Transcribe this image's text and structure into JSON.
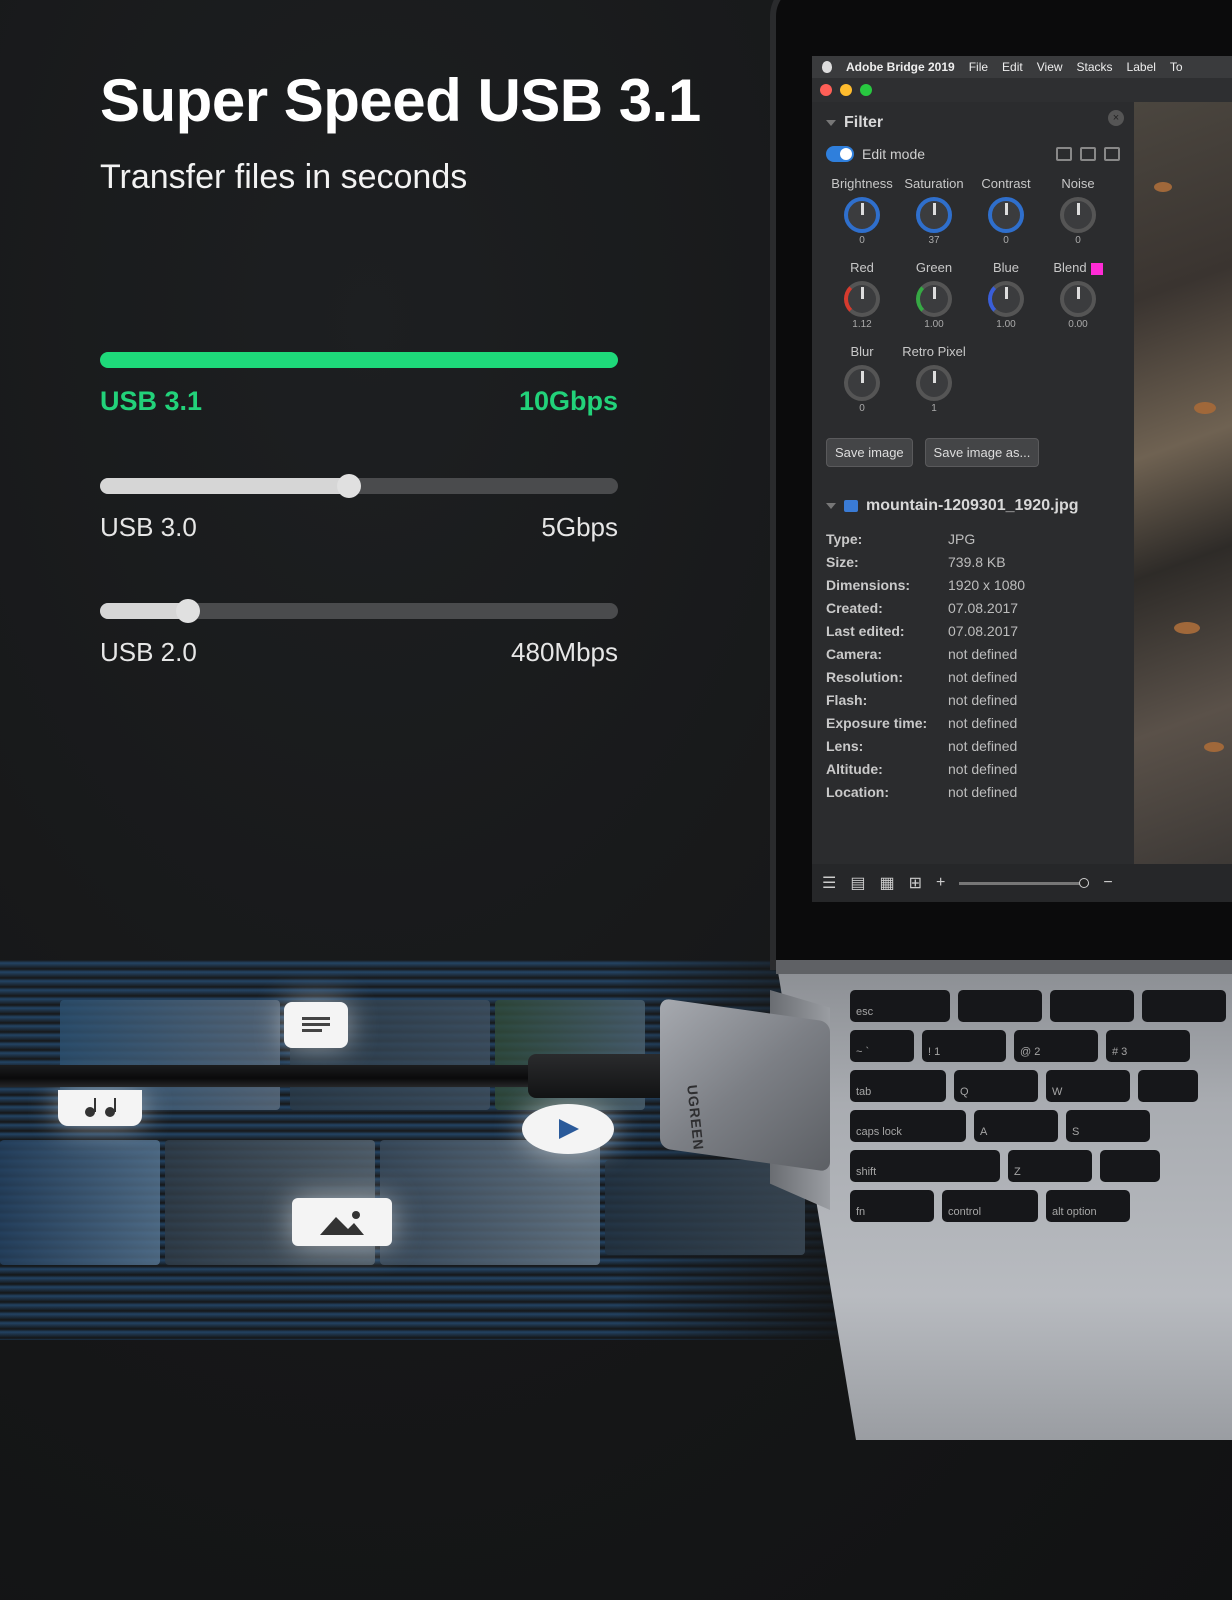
{
  "headline": "Super Speed USB 3.1",
  "subline": "Transfer files in seconds",
  "speeds": [
    {
      "name": "USB 3.1",
      "rate": "10Gbps",
      "level": 1.0
    },
    {
      "name": "USB 3.0",
      "rate": "5Gbps",
      "level": 0.48
    },
    {
      "name": "USB 2.0",
      "rate": "480Mbps",
      "level": 0.17
    }
  ],
  "colors": {
    "accent": "#1ed97a",
    "background": "#161718"
  },
  "app": {
    "menu": [
      "Adobe Bridge 2019",
      "File",
      "Edit",
      "View",
      "Stacks",
      "Label",
      "To"
    ],
    "filter": {
      "title": "Filter",
      "edit_mode": "Edit mode",
      "knobs": [
        {
          "label": "Brightness",
          "value": "0"
        },
        {
          "label": "Saturation",
          "value": "37"
        },
        {
          "label": "Contrast",
          "value": "0"
        },
        {
          "label": "Noise",
          "value": "0"
        },
        {
          "label": "Red",
          "value": "1.12"
        },
        {
          "label": "Green",
          "value": "1.00"
        },
        {
          "label": "Blue",
          "value": "1.00"
        },
        {
          "label": "Blend",
          "value": "0.00"
        },
        {
          "label": "Blur",
          "value": "0"
        },
        {
          "label": "Retro Pixel",
          "value": "1"
        }
      ],
      "save_button": "Save image",
      "save_as_button": "Save image as..."
    },
    "file": {
      "name": "mountain-1209301_1920.jpg",
      "meta": [
        {
          "k": "Type:",
          "v": "JPG"
        },
        {
          "k": "Size:",
          "v": "739.8 KB"
        },
        {
          "k": "Dimensions:",
          "v": "1920 x 1080"
        },
        {
          "k": "Created:",
          "v": "07.08.2017"
        },
        {
          "k": "Last edited:",
          "v": "07.08.2017"
        },
        {
          "k": "Camera:",
          "v": "not defined"
        },
        {
          "k": "Resolution:",
          "v": "not defined"
        },
        {
          "k": "Flash:",
          "v": "not defined"
        },
        {
          "k": "Exposure time:",
          "v": "not defined"
        },
        {
          "k": "Lens:",
          "v": "not defined"
        },
        {
          "k": "Altitude:",
          "v": "not defined"
        },
        {
          "k": "Location:",
          "v": "not defined"
        }
      ]
    }
  },
  "keyboard": {
    "rows": [
      [
        "esc",
        "",
        "",
        ""
      ],
      [
        "~ `",
        "! 1",
        "@ 2",
        "# 3"
      ],
      [
        "tab",
        "Q",
        "W",
        ""
      ],
      [
        "caps lock",
        "A",
        "S",
        ""
      ],
      [
        "shift",
        "Z",
        ""
      ],
      [
        "fn",
        "control",
        "alt option",
        ""
      ]
    ]
  },
  "brand": "UGREEN"
}
